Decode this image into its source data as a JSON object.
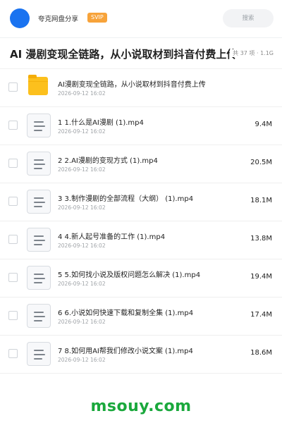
{
  "header": {
    "site_name": "夸克网盘分享",
    "badge": "SVIP",
    "search_placeholder": "搜索",
    "accent_color": "#1a73f0",
    "badge_color": "#f7a33a"
  },
  "title_bar": {
    "title": "AI 漫剧变现全链路，从小说取材到抖音付费上传",
    "meta": "共 37 项 · 1.1G"
  },
  "files": [
    {
      "type": "folder",
      "name": "AI漫剧变现全链路，从小说取材到抖音付费上传",
      "date": "2026-09-12 16:02",
      "size": ""
    },
    {
      "type": "file",
      "name": "1 1.什么是AI漫剧 (1).mp4",
      "date": "2026-09-12 16:02",
      "size": "9.4M"
    },
    {
      "type": "file",
      "name": "2 2.AI漫剧的变现方式 (1).mp4",
      "date": "2026-09-12 16:02",
      "size": "20.5M"
    },
    {
      "type": "file",
      "name": "3 3.制作漫剧的全部流程（大纲） (1).mp4",
      "date": "2026-09-12 16:02",
      "size": "18.1M"
    },
    {
      "type": "file",
      "name": "4 4.新人起号准备的工作 (1).mp4",
      "date": "2026-09-12 16:02",
      "size": "13.8M"
    },
    {
      "type": "file",
      "name": "5 5.如何找小说及版权问题怎么解决 (1).mp4",
      "date": "2026-09-12 16:02",
      "size": "19.4M"
    },
    {
      "type": "file",
      "name": "6 6.小说如何快速下载和复制全集 (1).mp4",
      "date": "2026-09-12 16:02",
      "size": "17.4M"
    },
    {
      "type": "file",
      "name": "7 8.如何用AI帮我们修改小说文案 (1).mp4",
      "date": "2026-09-12 16:02",
      "size": "18.6M"
    }
  ],
  "footer": {
    "watermark": "msouy.com",
    "watermark_color": "#1aa83c"
  }
}
